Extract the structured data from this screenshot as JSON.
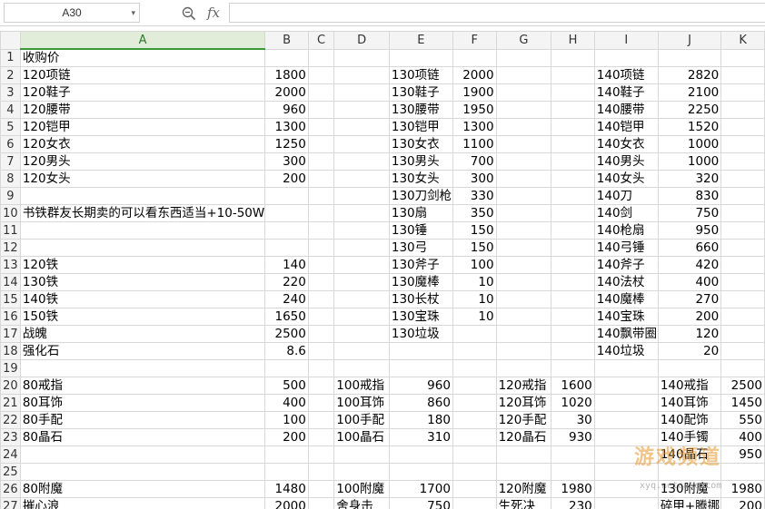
{
  "formula_bar": {
    "cell_ref": "A30",
    "formula": "",
    "fx_label": "fx"
  },
  "columns": [
    "A",
    "B",
    "C",
    "D",
    "E",
    "F",
    "G",
    "H",
    "I",
    "J",
    "K"
  ],
  "rows": [
    [
      "收购价",
      "",
      "",
      "",
      "",
      "",
      "",
      "",
      "",
      "",
      ""
    ],
    [
      "120项链",
      "1800",
      "",
      "",
      "130项链",
      "2000",
      "",
      "",
      "140项链",
      "2820",
      ""
    ],
    [
      "120鞋子",
      "2000",
      "",
      "",
      "130鞋子",
      "1900",
      "",
      "",
      "140鞋子",
      "2100",
      ""
    ],
    [
      "120腰带",
      "960",
      "",
      "",
      "130腰带",
      "1950",
      "",
      "",
      "140腰带",
      "2250",
      ""
    ],
    [
      "120铠甲",
      "1300",
      "",
      "",
      "130铠甲",
      "1300",
      "",
      "",
      "140铠甲",
      "1520",
      ""
    ],
    [
      "120女衣",
      "1250",
      "",
      "",
      "130女衣",
      "1100",
      "",
      "",
      "140女衣",
      "1000",
      ""
    ],
    [
      "120男头",
      "300",
      "",
      "",
      "130男头",
      "700",
      "",
      "",
      "140男头",
      "1000",
      ""
    ],
    [
      "120女头",
      "200",
      "",
      "",
      "130女头",
      "300",
      "",
      "",
      "140女头",
      "320",
      ""
    ],
    [
      "",
      "",
      "",
      "",
      "130刀剑枪",
      "330",
      "",
      "",
      "140刀",
      "830",
      ""
    ],
    [
      "书铁群友长期卖的可以看东西适当+10-50W",
      "",
      "",
      "",
      "130扇",
      "350",
      "",
      "",
      "140剑",
      "750",
      ""
    ],
    [
      "",
      "",
      "",
      "",
      "130锤",
      "150",
      "",
      "",
      "140枪扇",
      "950",
      ""
    ],
    [
      "",
      "",
      "",
      "",
      "130弓",
      "150",
      "",
      "",
      "140弓锤",
      "660",
      ""
    ],
    [
      "120铁",
      "140",
      "",
      "",
      "130斧子",
      "100",
      "",
      "",
      "140斧子",
      "420",
      ""
    ],
    [
      "130铁",
      "220",
      "",
      "",
      "130魔棒",
      "10",
      "",
      "",
      "140法杖",
      "400",
      ""
    ],
    [
      "140铁",
      "240",
      "",
      "",
      "130长杖",
      "10",
      "",
      "",
      "140魔棒",
      "270",
      ""
    ],
    [
      "150铁",
      "1650",
      "",
      "",
      "130宝珠",
      "10",
      "",
      "",
      "140宝珠",
      "200",
      ""
    ],
    [
      "战魄",
      "2500",
      "",
      "",
      "130垃圾",
      "",
      "",
      "",
      "140飘带圈",
      "120",
      ""
    ],
    [
      "强化石",
      "8.6",
      "",
      "",
      "",
      "",
      "",
      "",
      "140垃圾",
      "20",
      ""
    ],
    [
      "",
      "",
      "",
      "",
      "",
      "",
      "",
      "",
      "",
      "",
      ""
    ],
    [
      "80戒指",
      "500",
      "",
      "100戒指",
      "960",
      "",
      "120戒指",
      "1600",
      "",
      "140戒指",
      "2500"
    ],
    [
      "80耳饰",
      "400",
      "",
      "100耳饰",
      "860",
      "",
      "120耳饰",
      "1020",
      "",
      "140耳饰",
      "1450"
    ],
    [
      "80手配",
      "100",
      "",
      "100手配",
      "180",
      "",
      "120手配",
      "30",
      "",
      "140配饰",
      "550"
    ],
    [
      "80晶石",
      "200",
      "",
      "100晶石",
      "310",
      "",
      "120晶石",
      "930",
      "",
      "140手镯",
      "400"
    ],
    [
      "",
      "",
      "",
      "",
      "",
      "",
      "",
      "",
      "",
      "140晶石",
      "950"
    ],
    [
      "",
      "",
      "",
      "",
      "",
      "",
      "",
      "",
      "",
      "",
      ""
    ],
    [
      "80附魔",
      "1480",
      "",
      "100附魔",
      "1700",
      "",
      "120附魔",
      "1980",
      "",
      "130附魔",
      "1980"
    ],
    [
      "摧心浪",
      "2000",
      "",
      "舍身击",
      "750",
      "",
      "生死决",
      "230",
      "",
      "碎甲+腾挪",
      "200"
    ],
    [
      "",
      "",
      "",
      "",
      "",
      "",
      "",
      "",
      "",
      "",
      ""
    ]
  ],
  "numeric_columns": [
    1,
    5,
    9
  ],
  "numeric_columns_lower": [
    1,
    4,
    7,
    10
  ],
  "lower_block_start_row": 20,
  "watermark": {
    "text": "游戏频道",
    "url": "xyq.netease.com"
  }
}
